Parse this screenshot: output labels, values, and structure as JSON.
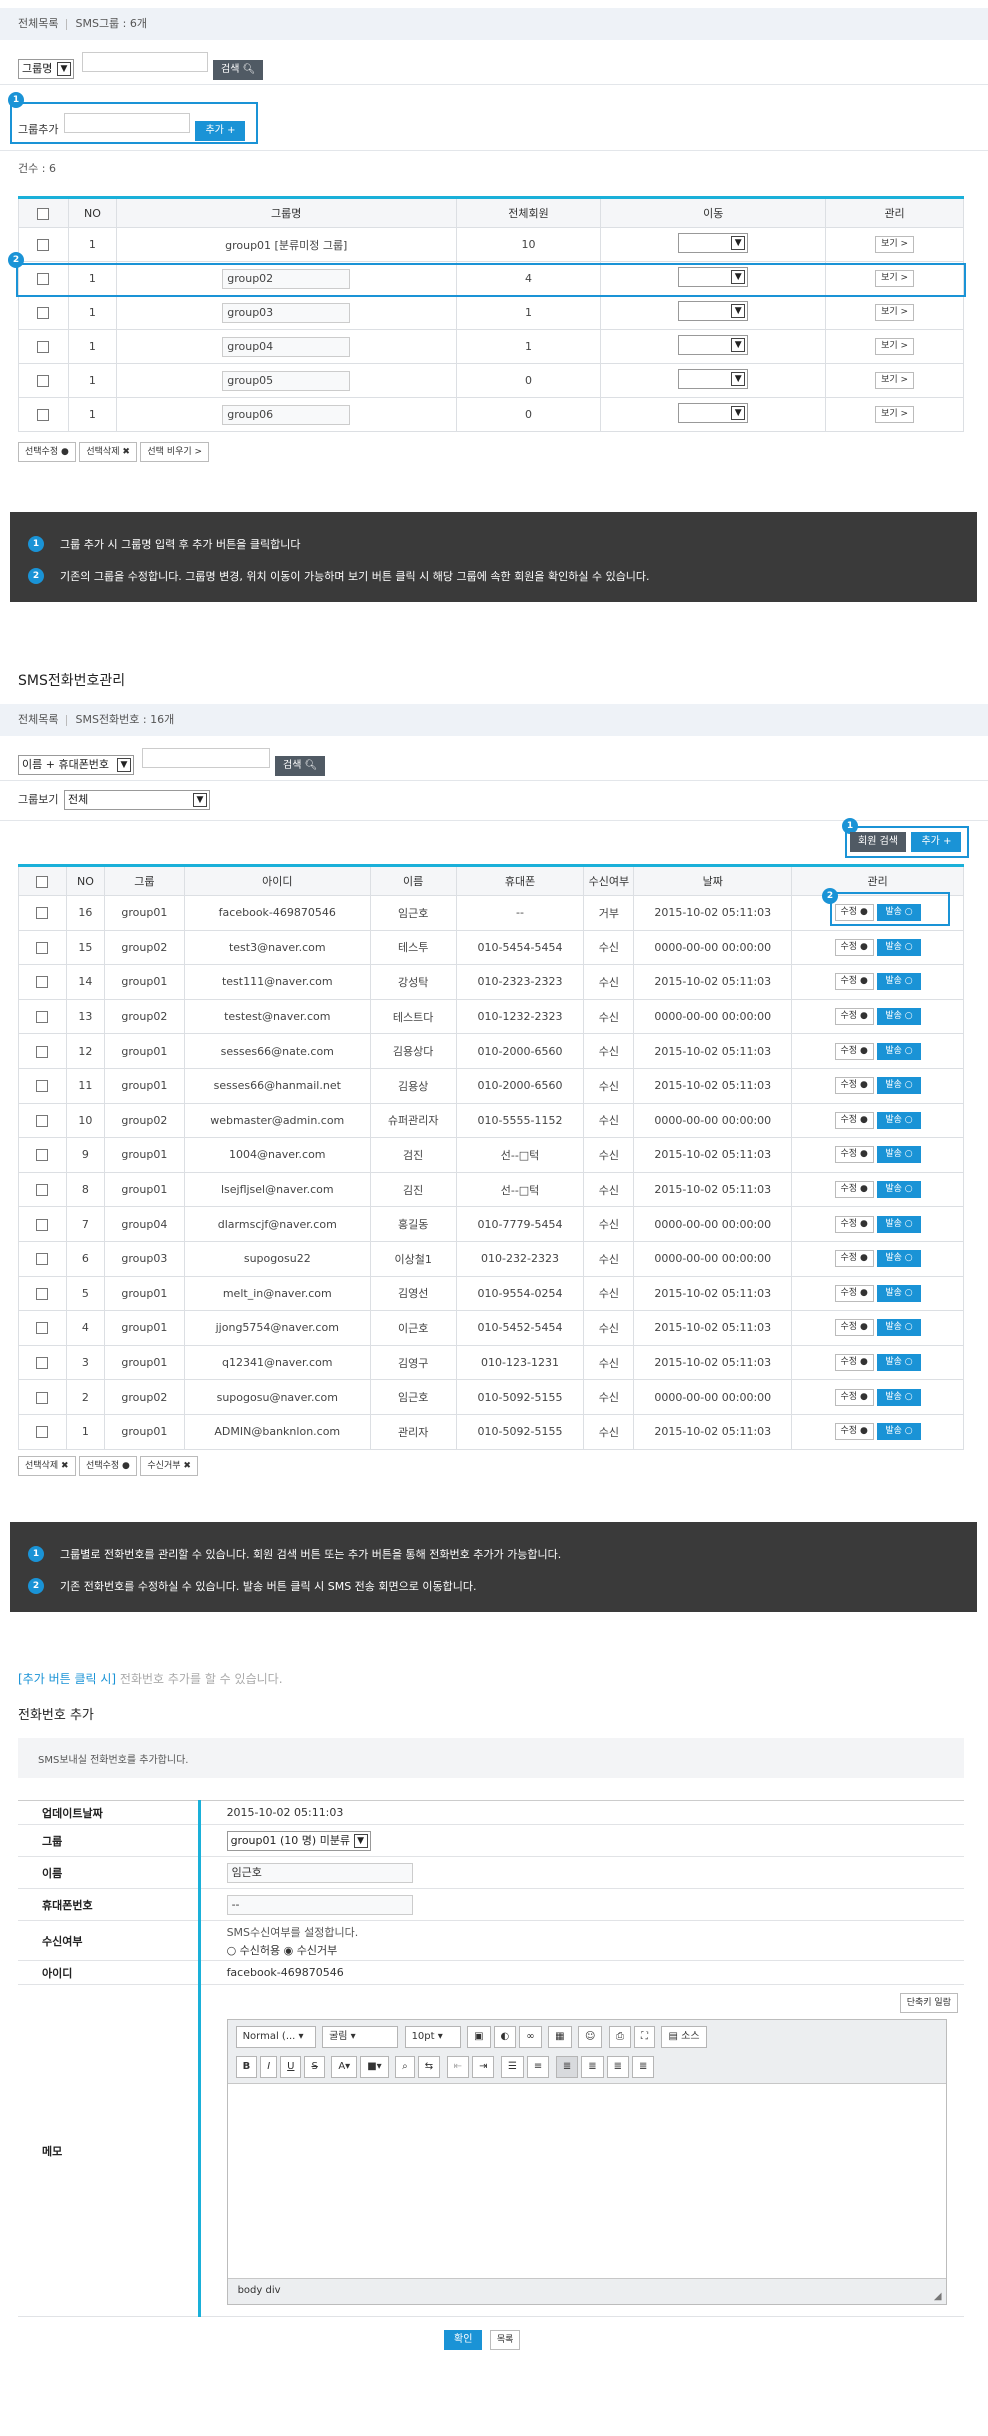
{
  "group_section": {
    "summary_all": "전체목록",
    "summary_count": "SMS그룹 : 6개",
    "search_select": "그룹명",
    "search_button": "검색",
    "add_label": "그룹추가",
    "add_button": "추가 +",
    "total_count": "건수 : 6",
    "headers": [
      "NO",
      "그룹명",
      "전체회원",
      "이동",
      "관리"
    ],
    "rows": [
      {
        "no": "1",
        "name": "group01 [분류미정 그룹]",
        "members": "10",
        "view": "보기 >"
      },
      {
        "no": "1",
        "name": "group02",
        "members": "4",
        "view": "보기 >"
      },
      {
        "no": "1",
        "name": "group03",
        "members": "1",
        "view": "보기 >"
      },
      {
        "no": "1",
        "name": "group04",
        "members": "1",
        "view": "보기 >"
      },
      {
        "no": "1",
        "name": "group05",
        "members": "0",
        "view": "보기 >"
      },
      {
        "no": "1",
        "name": "group06",
        "members": "0",
        "view": "보기 >"
      }
    ],
    "bottom_buttons": [
      "선택수정",
      "선택삭제",
      "선택 비우기 >"
    ],
    "notice": [
      "그룹 추가 시 그룹명 입력 후 추가 버튼을 클릭합니다",
      "기존의 그룹을 수정합니다. 그룹명 변경, 위치 이동이 가능하며 보기 버튼 클릭 시 해당 그룹에 속한 회원을 확인하실 수 있습니다."
    ]
  },
  "phone_section": {
    "title": "SMS전화번호관리",
    "summary_all": "전체목록",
    "summary_count": "SMS전화번호 : 16개",
    "search_select": "이름 + 휴대폰번호",
    "search_button": "검색",
    "group_view_label": "그룹보기",
    "group_view_value": "전체",
    "member_search_button": "회원 검색",
    "add_button": "추가 +",
    "headers": [
      "NO",
      "그룹",
      "아이디",
      "이름",
      "휴대폰",
      "수신여부",
      "날짜",
      "관리"
    ],
    "edit_label": "수정",
    "send_label": "발송",
    "rows": [
      {
        "no": "16",
        "group": "group01",
        "id": "facebook-469870546",
        "name": "임근호",
        "phone": "--",
        "recv": "거부",
        "date": "2015-10-02 05:11:03"
      },
      {
        "no": "15",
        "group": "group02",
        "id": "test3@naver.com",
        "name": "테스투",
        "phone": "010-5454-5454",
        "recv": "수신",
        "date": "0000-00-00 00:00:00"
      },
      {
        "no": "14",
        "group": "group01",
        "id": "test111@naver.com",
        "name": "강성탁",
        "phone": "010-2323-2323",
        "recv": "수신",
        "date": "2015-10-02 05:11:03"
      },
      {
        "no": "13",
        "group": "group02",
        "id": "testest@naver.com",
        "name": "테스트다",
        "phone": "010-1232-2323",
        "recv": "수신",
        "date": "0000-00-00 00:00:00"
      },
      {
        "no": "12",
        "group": "group01",
        "id": "sesses66@nate.com",
        "name": "김용상다",
        "phone": "010-2000-6560",
        "recv": "수신",
        "date": "2015-10-02 05:11:03"
      },
      {
        "no": "11",
        "group": "group01",
        "id": "sesses66@hanmail.net",
        "name": "김용상",
        "phone": "010-2000-6560",
        "recv": "수신",
        "date": "2015-10-02 05:11:03"
      },
      {
        "no": "10",
        "group": "group02",
        "id": "webmaster@admin.com",
        "name": "슈퍼관리자",
        "phone": "010-5555-1152",
        "recv": "수신",
        "date": "0000-00-00 00:00:00"
      },
      {
        "no": "9",
        "group": "group01",
        "id": "1004@naver.com",
        "name": "검진",
        "phone": "선--□턱",
        "recv": "수신",
        "date": "2015-10-02 05:11:03"
      },
      {
        "no": "8",
        "group": "group01",
        "id": "lsejfljsel@naver.com",
        "name": "김진",
        "phone": "선--□턱",
        "recv": "수신",
        "date": "2015-10-02 05:11:03"
      },
      {
        "no": "7",
        "group": "group04",
        "id": "dlarmscjf@naver.com",
        "name": "홍길동",
        "phone": "010-7779-5454",
        "recv": "수신",
        "date": "0000-00-00 00:00:00"
      },
      {
        "no": "6",
        "group": "group03",
        "id": "supogosu22",
        "name": "이상철1",
        "phone": "010-232-2323",
        "recv": "수신",
        "date": "0000-00-00 00:00:00"
      },
      {
        "no": "5",
        "group": "group01",
        "id": "melt_in@naver.com",
        "name": "김영선",
        "phone": "010-9554-0254",
        "recv": "수신",
        "date": "2015-10-02 05:11:03"
      },
      {
        "no": "4",
        "group": "group01",
        "id": "jjong5754@naver.com",
        "name": "이근호",
        "phone": "010-5452-5454",
        "recv": "수신",
        "date": "2015-10-02 05:11:03"
      },
      {
        "no": "3",
        "group": "group01",
        "id": "q12341@naver.com",
        "name": "김영구",
        "phone": "010-123-1231",
        "recv": "수신",
        "date": "2015-10-02 05:11:03"
      },
      {
        "no": "2",
        "group": "group02",
        "id": "supogosu@naver.com",
        "name": "임근호",
        "phone": "010-5092-5155",
        "recv": "수신",
        "date": "0000-00-00 00:00:00"
      },
      {
        "no": "1",
        "group": "group01",
        "id": "ADMIN@banknlon.com",
        "name": "관리자",
        "phone": "010-5092-5155",
        "recv": "수신",
        "date": "2015-10-02 05:11:03"
      }
    ],
    "bottom_buttons": [
      "선택삭제",
      "선택수정",
      "수신거부"
    ],
    "notice": [
      "그룹별로 전화번호를 관리할 수 있습니다. 회원 검색 버튼 또는 추가 버튼을 통해 전화번호 추가가 가능합니다.",
      "기존 전화번호를 수정하실 수 있습니다. 발송 버튼 클릭 시 SMS 전송 회면으로 이동합니다."
    ]
  },
  "add_form": {
    "caption_bold": "[추가 버튼 클릭 시]",
    "caption_rest": "전화번호 추가를 할 수 있습니다.",
    "title": "전화번호 추가",
    "desc": "SMS보내실 전화번호를 추가합니다.",
    "fields": {
      "updated_label": "업데이트날짜",
      "updated_value": "2015-10-02 05:11:03",
      "group_label": "그룹",
      "group_value": "group01 (10 명) 미분류",
      "name_label": "이름",
      "name_value": "임근호",
      "phone_label": "휴대폰번호",
      "phone_value": "--",
      "recv_label": "수신여부",
      "recv_help": "SMS수신여부를 설정합니다.",
      "recv_allow": "수신허용",
      "recv_deny": "수신거부",
      "id_label": "아이디",
      "id_value": "facebook-469870546",
      "memo_label": "메모"
    },
    "shortcut_button": "단축키 일람",
    "editor": {
      "style": "Normal (...",
      "font": "굴림",
      "size": "10pt",
      "source": "소스",
      "path": "body  div"
    },
    "confirm_button": "확인",
    "list_button": "목록"
  }
}
